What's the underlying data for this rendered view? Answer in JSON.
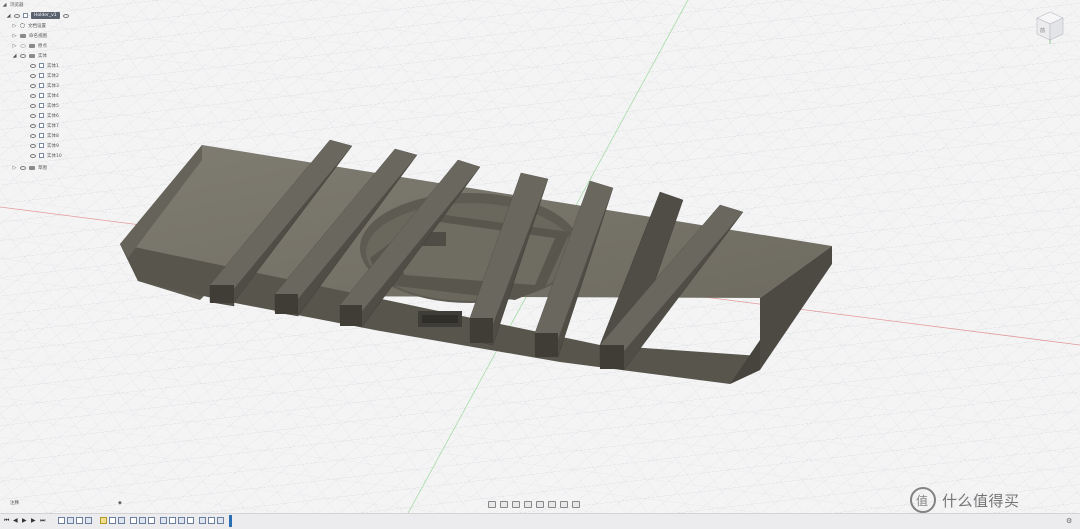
{
  "app": "Autodesk Fusion 360",
  "browser": {
    "header_label": "浏览器",
    "root_label": "Holder_v1",
    "items": [
      {
        "label": "文档设置",
        "icon": "gear-icon"
      },
      {
        "label": "命名视图",
        "icon": "folder-icon"
      },
      {
        "label": "原点",
        "icon": "folder-icon"
      },
      {
        "label": "实体",
        "icon": "folder-icon"
      },
      {
        "label": "实体1",
        "icon": "body-icon"
      },
      {
        "label": "实体2",
        "icon": "body-icon"
      },
      {
        "label": "实体3",
        "icon": "body-icon"
      },
      {
        "label": "实体4",
        "icon": "body-icon"
      },
      {
        "label": "实体5",
        "icon": "body-icon"
      },
      {
        "label": "实体6",
        "icon": "body-icon"
      },
      {
        "label": "实体7",
        "icon": "body-icon"
      },
      {
        "label": "实体8",
        "icon": "body-icon"
      },
      {
        "label": "实体9",
        "icon": "body-icon"
      },
      {
        "label": "实体10",
        "icon": "body-icon"
      },
      {
        "label": "草图",
        "icon": "folder-icon"
      }
    ]
  },
  "viewcube": {
    "face_label": "前"
  },
  "comments": {
    "label": "注释"
  },
  "watermark": {
    "text": "什么值得买"
  },
  "colors": {
    "background": "#f4f4f5",
    "grid": "#cfd3d8",
    "model_top": "#7a776c",
    "model_side": "#57554c",
    "model_dark": "#46443d",
    "axis_red": "#e07c7c",
    "axis_green": "#8fd08f",
    "timeline_marker": "#2a6fb5"
  }
}
